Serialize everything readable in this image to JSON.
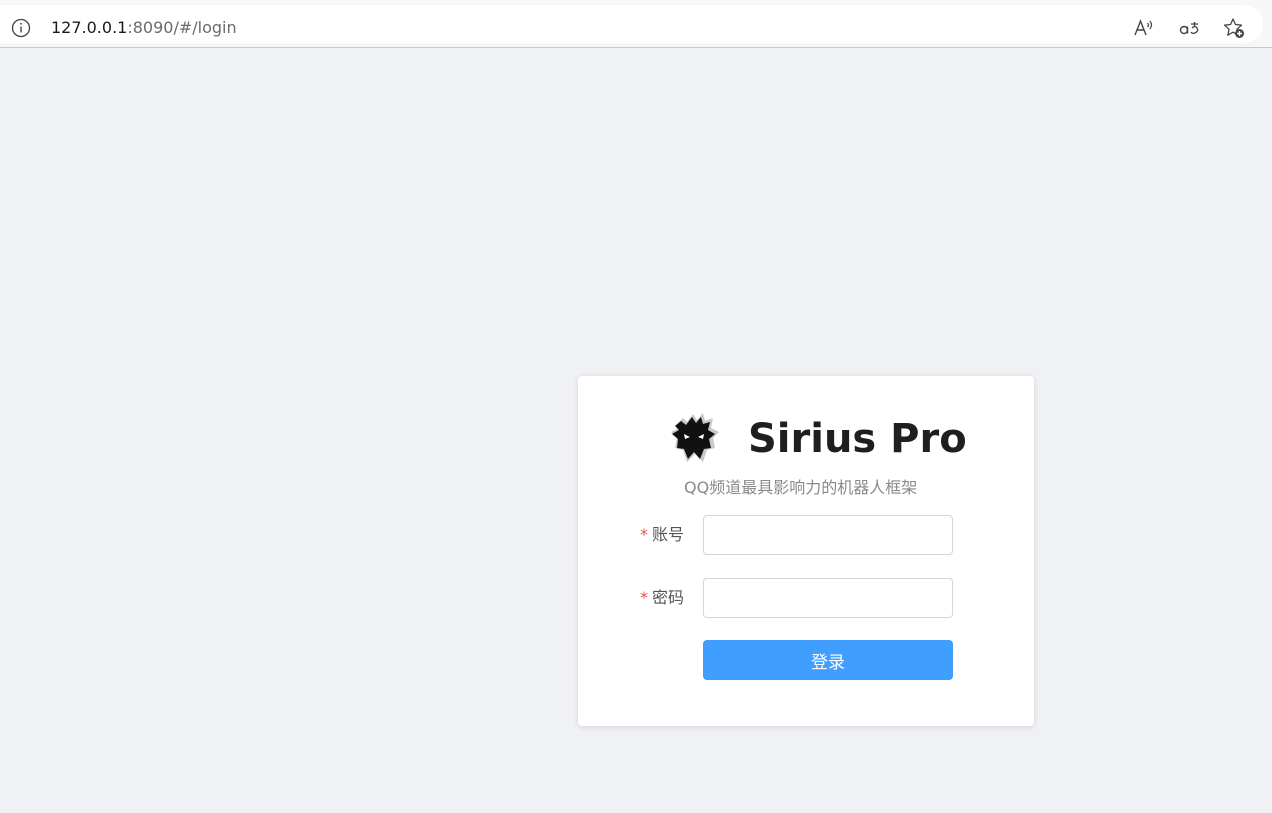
{
  "browser": {
    "url_host": "127.0.0.1",
    "url_rest": ":8090/#/login",
    "icons": [
      "info-icon",
      "read-aloud-icon",
      "translate-icon",
      "favorite-icon"
    ]
  },
  "login": {
    "title": "Sirius Pro",
    "subtitle": "QQ频道最具影响力的机器人框架",
    "required_mark": "*",
    "account_label": "账号",
    "account_value": "",
    "password_label": "密码",
    "password_value": "",
    "submit_label": "登录"
  },
  "colors": {
    "background": "#f0f1f4",
    "primary": "#409eff",
    "required": "#e95050"
  }
}
